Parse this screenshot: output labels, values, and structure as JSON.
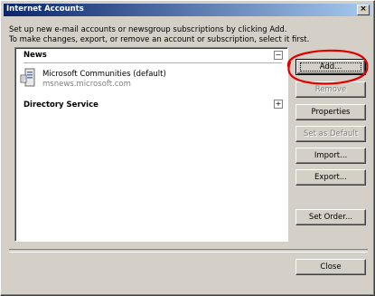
{
  "window": {
    "title": "Internet Accounts",
    "close_glyph": "×"
  },
  "instructions": {
    "line1": "Set up new e-mail accounts or newsgroup subscriptions by clicking Add.",
    "line2": "To make changes, export, or remove an account or subscription, select it first."
  },
  "list": {
    "groups": [
      {
        "header": "News",
        "expander": "−",
        "accounts": [
          {
            "name": "Microsoft Communities (default)",
            "server": "msnews.microsoft.com",
            "icon": "newsgroup-server-icon"
          }
        ]
      },
      {
        "header": "Directory Service",
        "expander": "+"
      }
    ]
  },
  "buttons": {
    "add": "Add...",
    "remove": "Remove",
    "properties": "Properties",
    "set_default": "Set as Default",
    "import": "Import...",
    "export": "Export...",
    "set_order": "Set Order...",
    "close": "Close"
  },
  "annotation": {
    "color": "#e00000",
    "shape": "ellipse-around-add-button"
  }
}
